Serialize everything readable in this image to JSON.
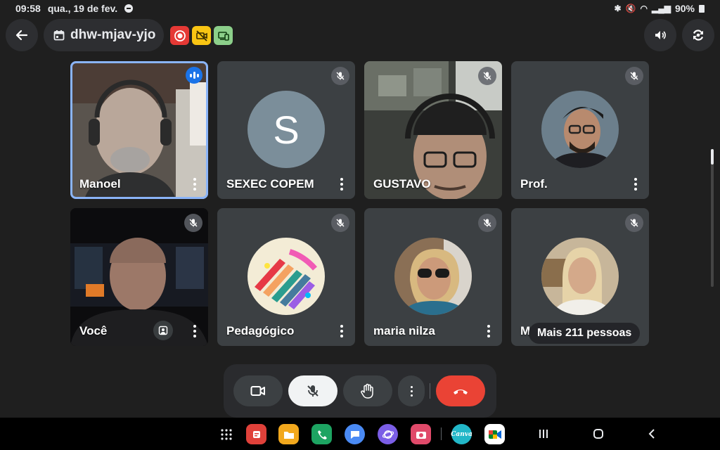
{
  "status_bar": {
    "time": "09:58",
    "date": "qua., 19 de fev.",
    "battery": "90%"
  },
  "meeting": {
    "code": "dhw-mjav-yjo",
    "more_people": "Mais 211 pessoas"
  },
  "participants": [
    {
      "name": "Manoel",
      "type": "video",
      "speaking": true
    },
    {
      "name": "SEXEC COPEM",
      "type": "letter",
      "letter": "S",
      "muted": true
    },
    {
      "name": "GUSTAVO",
      "type": "video",
      "muted": true
    },
    {
      "name": "Prof.",
      "type": "photo",
      "muted": true
    },
    {
      "name": "Você",
      "type": "video",
      "muted": true,
      "self": true
    },
    {
      "name": "Pedagógico",
      "type": "photo",
      "muted": true
    },
    {
      "name": "maria nilza",
      "type": "photo",
      "muted": true
    },
    {
      "name": "M",
      "type": "photo",
      "muted": true
    }
  ],
  "controls": [
    "camera-button",
    "mic-off-button",
    "raise-hand-button",
    "more-options-button",
    "leave-call-button"
  ],
  "nav_apps": [
    {
      "name": "apps-drawer",
      "color": "#000000"
    },
    {
      "name": "app-red",
      "color": "#e0413a"
    },
    {
      "name": "app-files",
      "color": "#f2a81d"
    },
    {
      "name": "app-phone",
      "color": "#1da462"
    },
    {
      "name": "app-messages",
      "color": "#4a8af4"
    },
    {
      "name": "app-internet",
      "color": "#7b5ee6"
    },
    {
      "name": "app-camera",
      "color": "#e04a6a"
    },
    {
      "name": "app-canva",
      "color": "#22b7c8",
      "label": "Canva"
    },
    {
      "name": "app-meet",
      "color": "#ffffff"
    }
  ],
  "colors": {
    "background": "#1f1f1f",
    "tile": "#3c4043",
    "leave": "#ea4335",
    "active_border": "#8ab4f8"
  }
}
